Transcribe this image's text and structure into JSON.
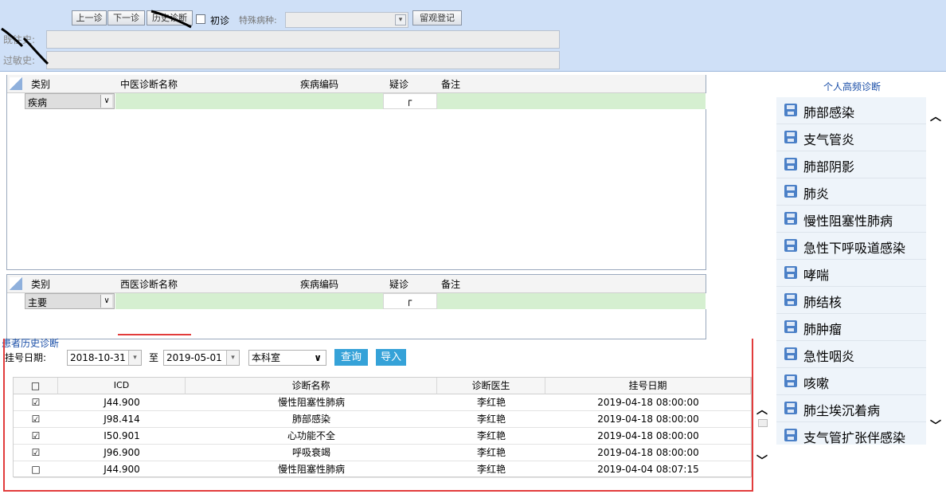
{
  "toolbar": {
    "prev_label": "上一诊",
    "next_label": "下一诊",
    "history_label": "历史诊断",
    "first_visit_label": "初诊",
    "special_disease_label": "特殊病种:",
    "observation_label": "留观登记"
  },
  "fields": {
    "present_history_label": "既往史:",
    "past_history_label": "过敏史:"
  },
  "tcm_grid": {
    "headers": [
      "类别",
      "中医诊断名称",
      "疾病编码",
      "疑诊",
      "备注"
    ],
    "row": {
      "category": "疾病",
      "suspect": "┌"
    }
  },
  "wm_grid": {
    "headers": [
      "类别",
      "西医诊断名称",
      "疾病编码",
      "疑诊",
      "备注"
    ],
    "row": {
      "category": "主要",
      "suspect": "┌"
    }
  },
  "right_panel": {
    "title": "个人高频诊断",
    "items": [
      "肺部感染",
      "支气管炎",
      "肺部阴影",
      "肺炎",
      "慢性阻塞性肺病",
      "急性下呼吸道感染",
      "哮喘",
      "肺结核",
      "肺肿瘤",
      "急性咽炎",
      "咳嗽",
      "肺尘埃沉着病",
      "支气管扩张伴感染"
    ]
  },
  "history": {
    "title": "患者历史诊断",
    "date_label": "挂号日期:",
    "date_from": "2018-10-31",
    "to_label": "至",
    "date_to": "2019-05-01",
    "dept": "本科室",
    "query_label": "查询",
    "import_label": "导入",
    "columns": [
      "□",
      "ICD",
      "诊断名称",
      "诊断医生",
      "挂号日期"
    ],
    "rows": [
      {
        "checked": "☑",
        "icd": "J44.900",
        "name": "慢性阻塞性肺病",
        "doctor": "李红艳",
        "date": "2019-04-18 08:00:00"
      },
      {
        "checked": "☑",
        "icd": "J98.414",
        "name": "肺部感染",
        "doctor": "李红艳",
        "date": "2019-04-18 08:00:00"
      },
      {
        "checked": "☑",
        "icd": "I50.901",
        "name": "心功能不全",
        "doctor": "李红艳",
        "date": "2019-04-18 08:00:00"
      },
      {
        "checked": "☑",
        "icd": "J96.900",
        "name": "呼吸衰竭",
        "doctor": "李红艳",
        "date": "2019-04-18 08:00:00"
      },
      {
        "checked": "□",
        "icd": "J44.900",
        "name": "慢性阻塞性肺病",
        "doctor": "李红艳",
        "date": "2019-04-04 08:07:15"
      }
    ]
  },
  "icons": {
    "freq_item_icon": "save-icon",
    "scroll_up": "chevron-up-icon",
    "scroll_down": "chevron-down-icon"
  },
  "colors": {
    "accent_blue": "#35a2d8",
    "highlight_red": "#e23c3c",
    "cell_green": "#d5efd0",
    "top_bg": "#cfe0f7"
  }
}
